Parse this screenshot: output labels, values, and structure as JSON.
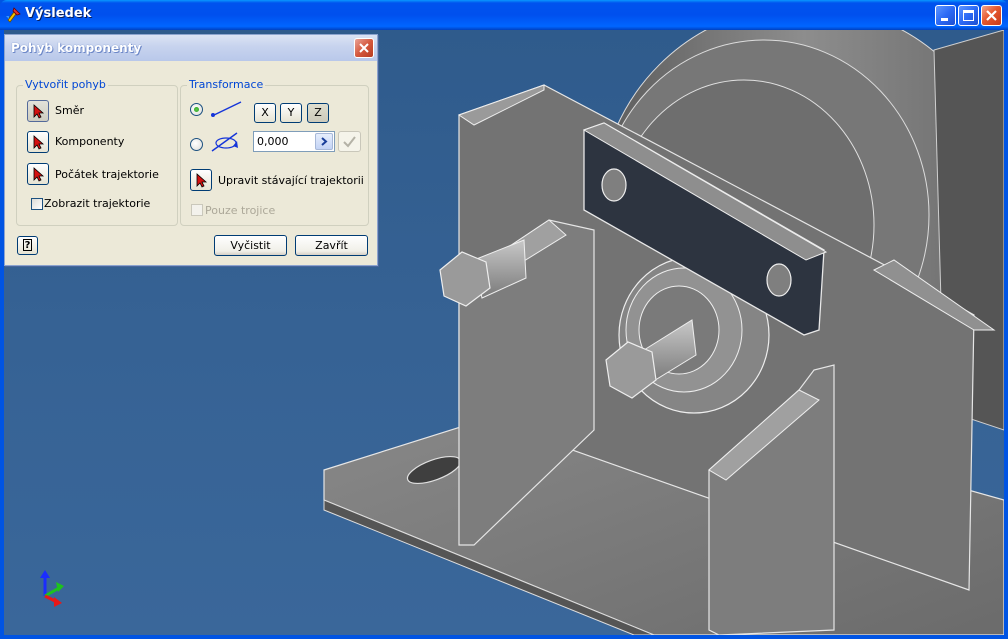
{
  "window": {
    "title": "Výsledek",
    "icons": {
      "app": "app-icon",
      "minimize": "minimize-icon",
      "maximize": "maximize-icon",
      "close": "close-icon"
    }
  },
  "dialog": {
    "title": "Pohyb komponenty",
    "left_group": {
      "title": "Vytvořit pohyb",
      "items": [
        {
          "label": "Směr",
          "pressed": true,
          "icon": "select-arrow-icon"
        },
        {
          "label": "Komponenty",
          "pressed": false,
          "icon": "select-arrow-icon"
        },
        {
          "label": "Počátek trajektorie",
          "pressed": false,
          "icon": "select-arrow-icon"
        }
      ],
      "show_trajectory": {
        "label": "Zobrazit trajektorie",
        "checked": false
      }
    },
    "right_group": {
      "title": "Transformace",
      "translate_selected": true,
      "axes": [
        "X",
        "Y",
        "Z"
      ],
      "active_axis": "Z",
      "rotation_value": "0,000",
      "edit_button": {
        "label": "Upravit stávající trajektorii",
        "icon": "select-arrow-icon"
      },
      "triads_only": {
        "label": "Pouze trojice",
        "checked": false,
        "disabled": true
      }
    },
    "buttons": {
      "clear": "Vyčistit",
      "close": "Zavřít",
      "help": "?"
    }
  },
  "viewport": {
    "triad_icon": "axis-triad-icon",
    "background": "#366294"
  }
}
